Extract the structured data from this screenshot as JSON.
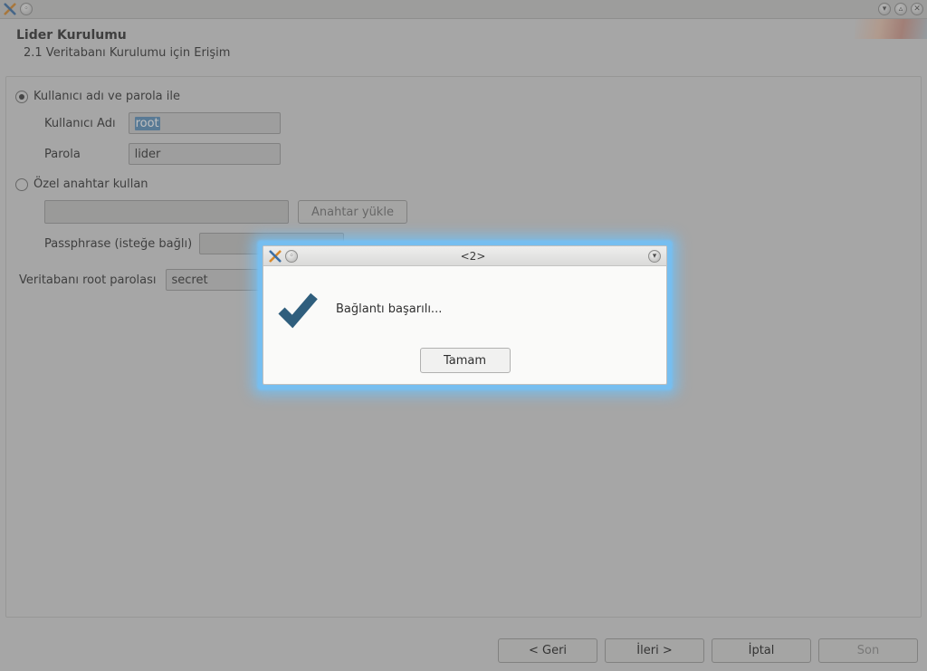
{
  "window": {
    "title": ""
  },
  "wizard": {
    "title": "Lider Kurulumu",
    "subtitle": "2.1 Veritabanı Kurulumu için Erişim",
    "radio_userpass_label": "Kullanıcı adı ve parola ile",
    "radio_privkey_label": "Özel anahtar kullan",
    "username_label": "Kullanıcı Adı",
    "username_value": "root",
    "password_label": "Parola",
    "password_value": "lider",
    "key_load_button": "Anahtar yükle",
    "passphrase_label": "Passphrase (isteğe bağlı)",
    "root_pw_label": "Veritabanı root parolası",
    "root_pw_value": "secret",
    "buttons": {
      "back": "<  Geri",
      "next": "İleri  >",
      "cancel": "İptal",
      "finish": "Son"
    }
  },
  "modal": {
    "title": "<2>",
    "message": "Bağlantı başarılı...",
    "ok_button": "Tamam"
  }
}
